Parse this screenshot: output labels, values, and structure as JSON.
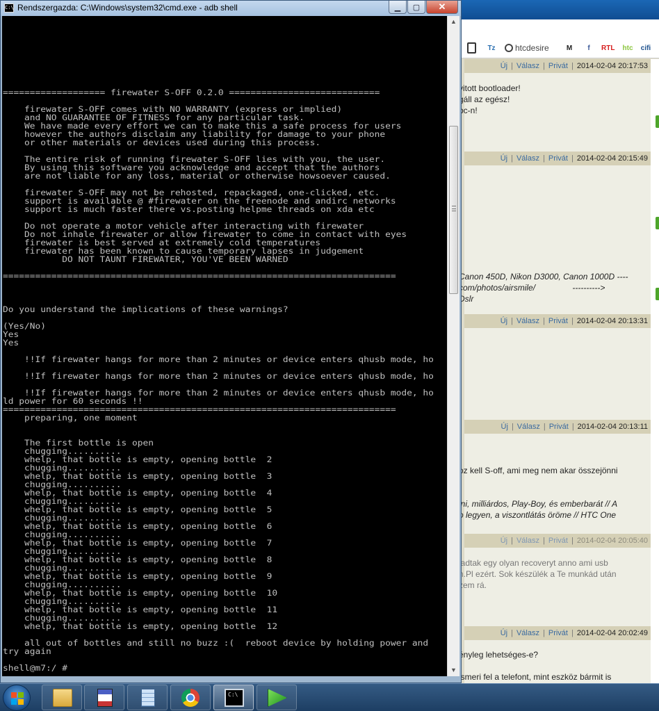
{
  "cmd": {
    "title": "Rendszergazda: C:\\Windows\\system32\\cmd.exe - adb  shell",
    "icon_text": "C:\\",
    "buttons": {
      "minimize": "▁",
      "maximize": "▢",
      "close": "✕"
    },
    "console_lines": [
      "=================== firewater S-OFF 0.2.0 ============================",
      "",
      "    firewater S-OFF comes with NO WARRANTY (express or implied)",
      "    and NO GUARANTEE OF FITNESS for any particular task.",
      "    We have made every effort we can to make this a safe process for users",
      "    however the authors disclaim any liability for damage to your phone",
      "    or other materials or devices used during this process.",
      "",
      "    The entire risk of running firewater S-OFF lies with you, the user.",
      "    By using this software you acknowledge and accept that the authors",
      "    are not liable for any loss, material or otherwise howsoever caused.",
      "",
      "    firewater S-OFF may not be rehosted, repackaged, one-clicked, etc.",
      "    support is available @ #firewater on the freenode and andirc networks",
      "    support is much faster there vs.posting helpme threads on xda etc",
      "",
      "    Do not operate a motor vehicle after interacting with firewater",
      "    Do not inhale firewater or allow firewater to come in contact with eyes",
      "    firewater is best served at extremely cold temperatures",
      "    firewater has been known to cause temporary lapses in judgement",
      "           DO NOT TAUNT FIREWATER, YOU'VE BEEN WARNED",
      "",
      "=========================================================================",
      "",
      "",
      "",
      "Do you understand the implications of these warnings?",
      "",
      "(Yes/No)",
      "Yes",
      "Yes",
      "",
      "    !!If firewater hangs for more than 2 minutes or device enters qhusb mode, ho",
      "",
      "    !!If firewater hangs for more than 2 minutes or device enters qhusb mode, ho",
      "",
      "    !!If firewater hangs for more than 2 minutes or device enters qhusb mode, ho",
      "ld power for 60 seconds !!",
      "=========================================================================",
      "    preparing, one moment",
      "",
      "",
      "    The first bottle is open",
      "    chugging..........",
      "    whelp, that bottle is empty, opening bottle  2",
      "    chugging..........",
      "    whelp, that bottle is empty, opening bottle  3",
      "    chugging..........",
      "    whelp, that bottle is empty, opening bottle  4",
      "    chugging..........",
      "    whelp, that bottle is empty, opening bottle  5",
      "    chugging..........",
      "    whelp, that bottle is empty, opening bottle  6",
      "    chugging..........",
      "    whelp, that bottle is empty, opening bottle  7",
      "    chugging..........",
      "    whelp, that bottle is empty, opening bottle  8",
      "    chugging..........",
      "    whelp, that bottle is empty, opening bottle  9",
      "    chugging..........",
      "    whelp, that bottle is empty, opening bottle  10",
      "    chugging..........",
      "    whelp, that bottle is empty, opening bottle  11",
      "    chugging..........",
      "    whelp, that bottle is empty, opening bottle  12",
      "",
      "    all out of bottles and still no buzz :(  reboot device by holding power and",
      "try again",
      "",
      "shell@m7:/ #"
    ]
  },
  "browser": {
    "toolbar_items": [
      {
        "label": "",
        "icon": "page-icon",
        "color": "#333333"
      },
      {
        "label": "Tz",
        "icon": "tz-icon",
        "color": "#2a6fb0"
      },
      {
        "label": "htcdesire",
        "icon": "search-icon",
        "color": "#444444"
      },
      {
        "label": "M",
        "icon": "m-icon",
        "color": "#222222"
      },
      {
        "label": "f",
        "icon": "facebook-icon",
        "color": "#3b5998"
      },
      {
        "label": "RTL",
        "icon": "rtl-icon",
        "color": "#d61d1d"
      },
      {
        "label": "htc",
        "icon": "htc-icon",
        "color": "#8cc63f"
      },
      {
        "label": "cifi",
        "icon": "cifi-icon",
        "color": "#1a4f8c"
      }
    ],
    "posts": [
      {
        "links": [
          "Új",
          "Válasz",
          "Privát"
        ],
        "date": "2014-02-04 20:17:53",
        "faded": false,
        "body": "vitott bootloader!\ngáll az egész!\nbc-n!",
        "style": ""
      },
      {
        "links": [
          "Új",
          "Válasz",
          "Privát"
        ],
        "date": "2014-02-04 20:15:49",
        "faded": false,
        "body": "Canon 450D, Nikon D3000, Canon 1000D ----\ncom/photos/airsmile/                ---------->\nDslr",
        "style": "italic"
      },
      {
        "links": [
          "Új",
          "Válasz",
          "Privát"
        ],
        "date": "2014-02-04 20:13:31",
        "faded": false,
        "body": "",
        "style": ""
      },
      {
        "links": [
          "Új",
          "Válasz",
          "Privát"
        ],
        "date": "2014-02-04 20:13:11",
        "faded": false,
        "body": "oz kell S-off, ami meg nem akar összejönni\n\n\nini, milliárdos, Play-Boy, és emberbarát // A\no legyen, a viszontlátás öröme // HTC One",
        "style": "mixed"
      },
      {
        "links": [
          "Új",
          "Válasz",
          "Privát"
        ],
        "date": "2014-02-04 20:05:40",
        "faded": true,
        "body": "iadtak egy olyan recoveryt anno ami usb\nn.Pl ezért. Sok készülék a Te munkád után\nzem rá.",
        "style": "grey"
      },
      {
        "links": [
          "Új",
          "Válasz",
          "Privát"
        ],
        "date": "2014-02-04 20:02:49",
        "faded": false,
        "body": "ényleg lehetséges-e?\n\nismeri fel a telefont, mint eszköz bármit is",
        "style": ""
      }
    ]
  },
  "taskbar": {
    "items": [
      {
        "name": "file-explorer",
        "icon": "folder-icon"
      },
      {
        "name": "save-app",
        "icon": "floppy-icon"
      },
      {
        "name": "calculator",
        "icon": "calculator-icon"
      },
      {
        "name": "chrome",
        "icon": "chrome-icon"
      },
      {
        "name": "cmd",
        "icon": "cmd-icon",
        "active": true
      },
      {
        "name": "media-player",
        "icon": "play-icon"
      }
    ]
  }
}
